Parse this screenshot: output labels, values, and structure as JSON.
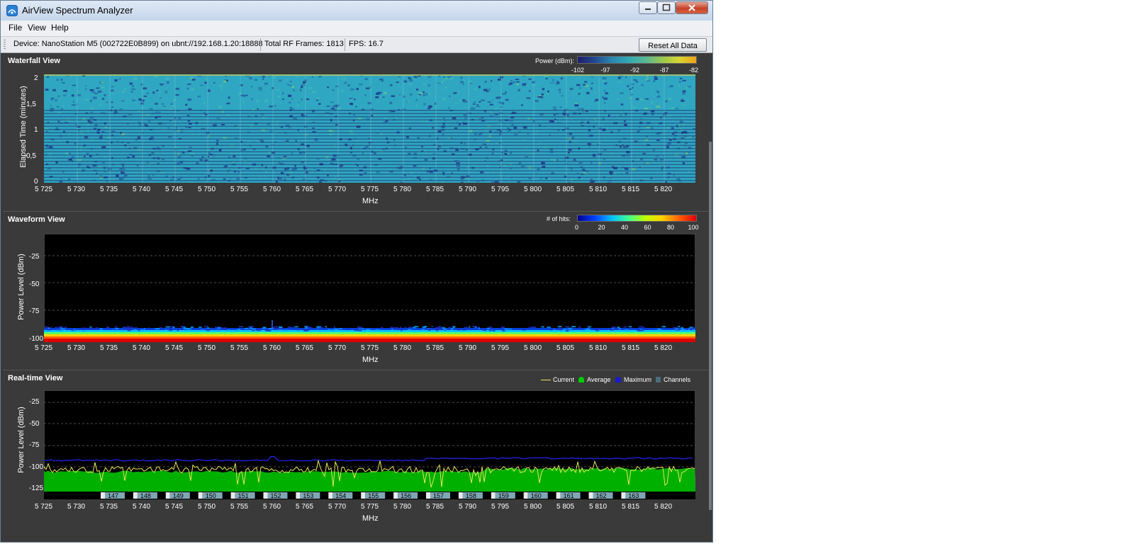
{
  "window": {
    "title": "AirView Spectrum Analyzer",
    "colors": {
      "frame_bg": "#3a3a3a",
      "plot_bg": "#000000",
      "waterfall_base": "#2fa7c2"
    }
  },
  "menu": {
    "items": [
      "File",
      "View",
      "Help"
    ]
  },
  "toolbar": {
    "device": "Device: NanoStation M5 (002722E0B899) on ubnt://192.168.1.20:18888",
    "frames": "Total RF Frames:  1813",
    "fps": "FPS:  16.7",
    "reset_label": "Reset All Data"
  },
  "waterfall": {
    "title": "Waterfall View",
    "legend_label": "Power (dBm):",
    "legend_ticks": [
      "-102",
      "-97",
      "-92",
      "-87",
      "-82"
    ],
    "ylabel": "Elapsed Time (minutes)",
    "yticks": [
      "2",
      "1,5",
      "1",
      "0,5",
      "0"
    ],
    "xlabel": "MHz"
  },
  "waveform": {
    "title": "Waveform View",
    "legend_label": "# of hits:",
    "legend_ticks": [
      "0",
      "20",
      "40",
      "60",
      "80",
      "100"
    ],
    "ylabel": "Power Level (dBm)",
    "yticks": [
      "-25",
      "-50",
      "-75",
      "-100"
    ],
    "xlabel": "MHz"
  },
  "realtime": {
    "title": "Real-time View",
    "legend": [
      "Current",
      "Average",
      "Maximum",
      "Channels"
    ],
    "legend_colors": [
      "#e8e85a",
      "#00cc00",
      "#1a1ad0",
      "#4a6e7d"
    ],
    "ylabel": "Power Level (dBm)",
    "yticks": [
      "-25",
      "-50",
      "-75",
      "-100",
      "-125"
    ],
    "xlabel": "MHz",
    "channels": [
      "147",
      "148",
      "149",
      "150",
      "151",
      "152",
      "153",
      "154",
      "155",
      "156",
      "157",
      "158",
      "159",
      "160",
      "161",
      "162",
      "163"
    ]
  },
  "xticks": [
    "5 725",
    "5 730",
    "5 735",
    "5 740",
    "5 745",
    "5 750",
    "5 755",
    "5 760",
    "5 765",
    "5 770",
    "5 775",
    "5 780",
    "5 785",
    "5 790",
    "5 795",
    "5 800",
    "5 805",
    "5 810",
    "5 815",
    "5 820"
  ]
}
